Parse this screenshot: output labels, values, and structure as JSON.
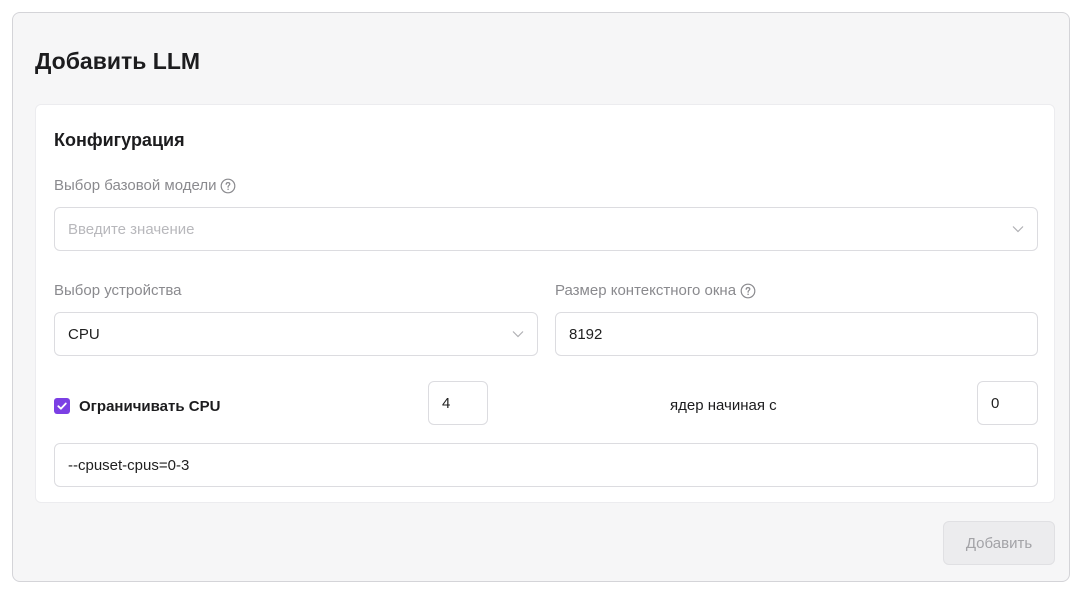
{
  "card": {
    "title": "Добавить LLM"
  },
  "config": {
    "title": "Конфигурация",
    "base_model": {
      "label": "Выбор базовой модели",
      "placeholder": "Введите значение"
    },
    "device": {
      "label": "Выбор устройства",
      "value": "CPU"
    },
    "context_window": {
      "label": "Размер контекстного окна",
      "value": "8192"
    },
    "limit_cpu": {
      "checked": true,
      "label": "Ограничивать CPU",
      "cores_value": "4",
      "mid_text": "ядер начиная с",
      "start_value": "0"
    },
    "cpuset": {
      "value": "--cpuset-cpus=0-3"
    }
  },
  "footer": {
    "add_label": "Добавить"
  },
  "colors": {
    "accent": "#7b3fe4",
    "muted_text": "#8a8a8e",
    "border": "#dcdce0"
  },
  "icons": {
    "help": "help-circle-icon",
    "dropdown": "chevron-down-icon",
    "check": "checkmark-icon"
  }
}
